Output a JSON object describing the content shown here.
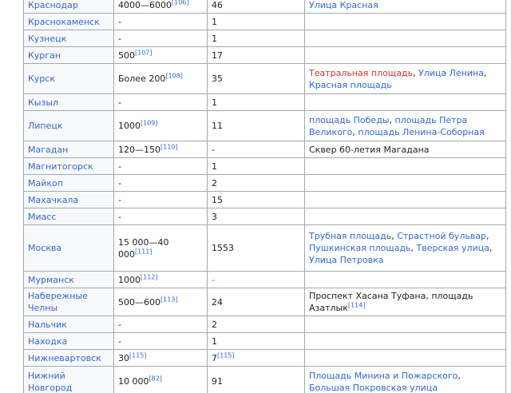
{
  "rows": [
    {
      "city": "Краснодар",
      "count": "4000—6000",
      "count_ref": "[106]",
      "events": "46",
      "events_ref": "",
      "places": [
        {
          "text": "Улица Красная",
          "link": true
        }
      ]
    },
    {
      "city": "Краснокаменск",
      "count": "-",
      "count_ref": "",
      "events": "1",
      "events_ref": "",
      "places": []
    },
    {
      "city": "Кузнецк",
      "count": "-",
      "count_ref": "",
      "events": "1",
      "events_ref": "",
      "places": []
    },
    {
      "city": "Курган",
      "count": "500",
      "count_ref": "[107]",
      "events": "17",
      "events_ref": "",
      "places": []
    },
    {
      "city": "Курск",
      "count": "Более 200",
      "count_ref": "[108]",
      "events": "35",
      "events_ref": "",
      "places": [
        {
          "text": "Театральная площадь",
          "link": true,
          "red": true
        },
        {
          "text": ", ",
          "link": false
        },
        {
          "text": "Улица Ленина",
          "link": true
        },
        {
          "text": ", ",
          "link": false
        },
        {
          "text": "Красная площадь",
          "link": true
        }
      ]
    },
    {
      "city": "Кызыл",
      "count": "-",
      "count_ref": "",
      "events": "1",
      "events_ref": "",
      "places": []
    },
    {
      "city": "Липецк",
      "count": "1000",
      "count_ref": "[109]",
      "events": "11",
      "events_ref": "",
      "places": [
        {
          "text": "площадь Победы",
          "link": true
        },
        {
          "text": ", ",
          "link": false
        },
        {
          "text": "площадь Петра Великого",
          "link": true
        },
        {
          "text": ", ",
          "link": false
        },
        {
          "text": "площадь Ленина-Соборная",
          "link": true
        }
      ]
    },
    {
      "city": "Магадан",
      "count": "120—150",
      "count_ref": "[110]",
      "events": "-",
      "events_ref": "",
      "places": [
        {
          "text": "Сквер 60-летия Магадана",
          "link": false
        }
      ]
    },
    {
      "city": "Магнитогорск",
      "count": "-",
      "count_ref": "",
      "events": "1",
      "events_ref": "",
      "places": []
    },
    {
      "city": "Майкоп",
      "count": "-",
      "count_ref": "",
      "events": "2",
      "events_ref": "",
      "places": []
    },
    {
      "city": "Махачкала",
      "count": "-",
      "count_ref": "",
      "events": "15",
      "events_ref": "",
      "places": []
    },
    {
      "city": "Миасс",
      "count": "-",
      "count_ref": "",
      "events": "3",
      "events_ref": "",
      "places": []
    },
    {
      "city": "Москва",
      "count": "15 000—40 000",
      "count_ref": "[111]",
      "events": "1553",
      "events_ref": "",
      "places": [
        {
          "text": "Трубная площадь",
          "link": true
        },
        {
          "text": ", ",
          "link": false
        },
        {
          "text": "Страстной бульвар",
          "link": true
        },
        {
          "text": ", ",
          "link": false
        },
        {
          "text": "Пушкинская площадь",
          "link": true
        },
        {
          "text": ", ",
          "link": false
        },
        {
          "text": "Тверская улица",
          "link": true
        },
        {
          "text": ", ",
          "link": false
        },
        {
          "text": "Улица Петровка",
          "link": true
        }
      ]
    },
    {
      "city": "Мурманск",
      "count": "1000",
      "count_ref": "[112]",
      "events": "-",
      "events_ref": "",
      "places": []
    },
    {
      "city": "Набережные Челны",
      "count": "500—600",
      "count_ref": "[113]",
      "events": "24",
      "events_ref": "",
      "places": [
        {
          "text": "Проспект Хасана Туфана, площадь Азатлык",
          "link": false
        },
        {
          "text": "[114]",
          "link": true,
          "sup": true
        }
      ]
    },
    {
      "city": "Нальчик",
      "count": "-",
      "count_ref": "",
      "events": "2",
      "events_ref": "",
      "places": []
    },
    {
      "city": "Находка",
      "count": "-",
      "count_ref": "",
      "events": "1",
      "events_ref": "",
      "places": []
    },
    {
      "city": "Нижневартовск",
      "count": "30",
      "count_ref": "[115]",
      "events": "7",
      "events_ref": "[115]",
      "places": []
    },
    {
      "city": "Нижний Новгород",
      "count": "10 000",
      "count_ref": "[82]",
      "events": "91",
      "events_ref": "",
      "places": [
        {
          "text": "Площадь Минина и Пожарского",
          "link": true
        },
        {
          "text": ", ",
          "link": false
        },
        {
          "text": "Большая Покровская улица",
          "link": true
        }
      ]
    }
  ],
  "colors": {
    "link": "#3366cc",
    "redlink": "#d33333",
    "border": "#a2a9b1",
    "header_bg": "#f8f9fa"
  }
}
